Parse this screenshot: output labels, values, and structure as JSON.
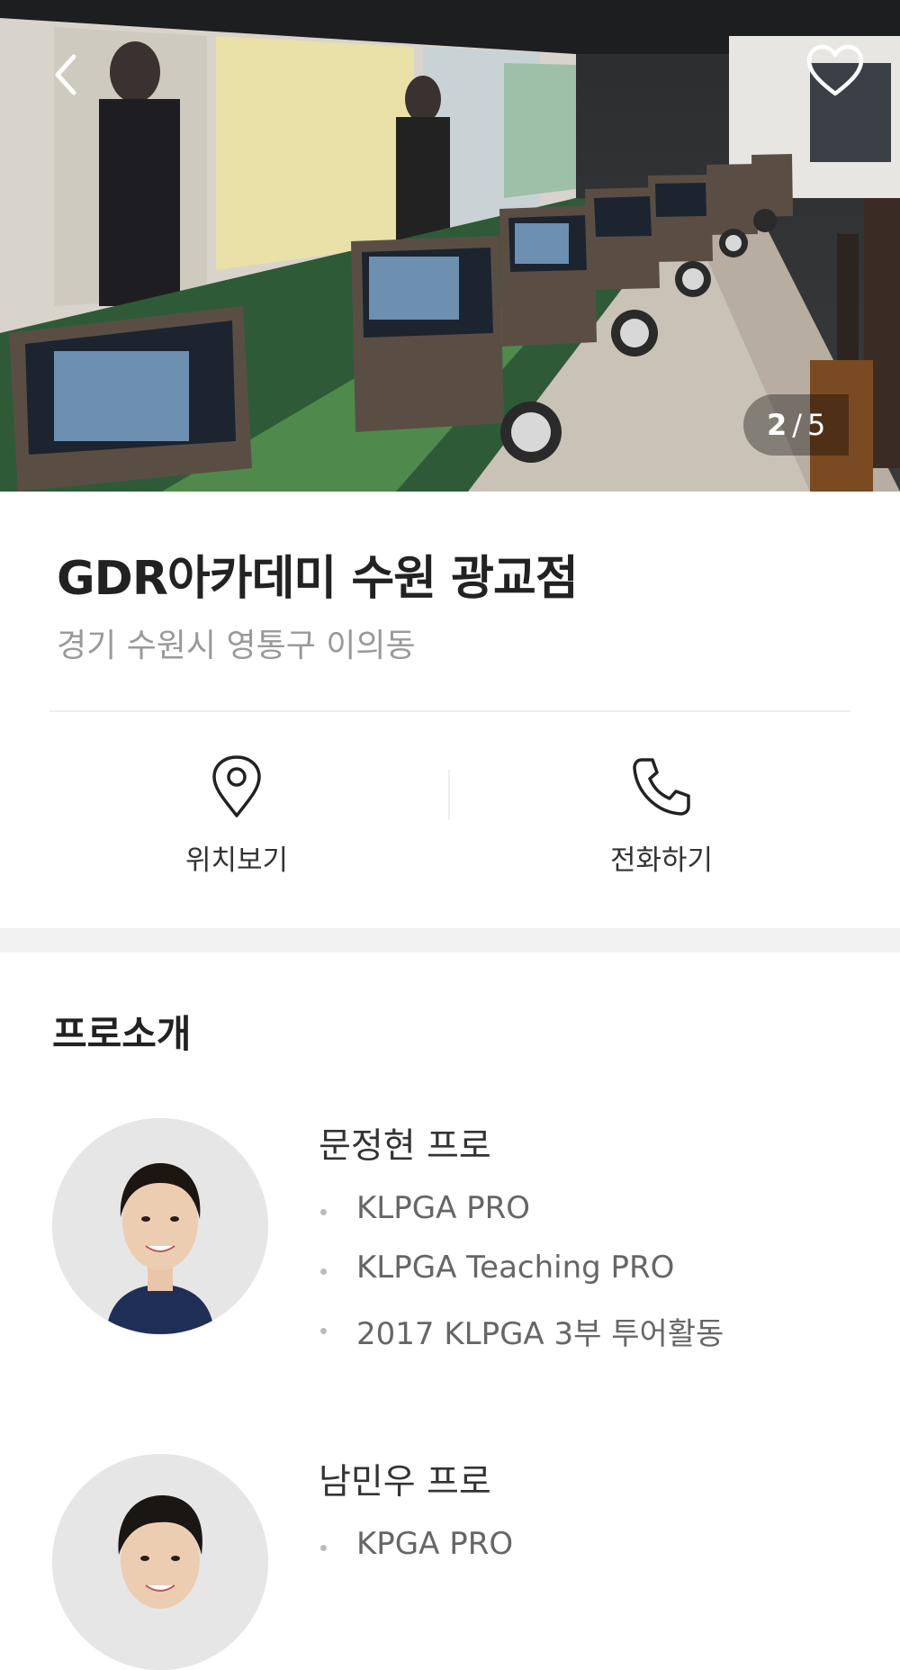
{
  "hero": {
    "counter": {
      "current": "2",
      "separator": "/",
      "total": "5"
    },
    "back_icon": "chevron-left-icon",
    "favorite_icon": "heart-outline-icon"
  },
  "academy": {
    "name": "GDR아카데미 수원 광교점",
    "address": "경기 수원시 영통구 이의동"
  },
  "actions": {
    "location_label": "위치보기",
    "call_label": "전화하기"
  },
  "pros_section": {
    "title": "프로소개",
    "pros": [
      {
        "name": "문정현 프로",
        "credentials": [
          "KLPGA PRO",
          "KLPGA Teaching PRO",
          "2017 KLPGA 3부 투어활동"
        ]
      },
      {
        "name": "남민우 프로",
        "credentials": [
          "KPGA PRO"
        ]
      }
    ]
  },
  "colors": {
    "title": "#222222",
    "subtext": "#999999",
    "divider": "#eeeeee",
    "section_gap": "#f2f2f2"
  }
}
